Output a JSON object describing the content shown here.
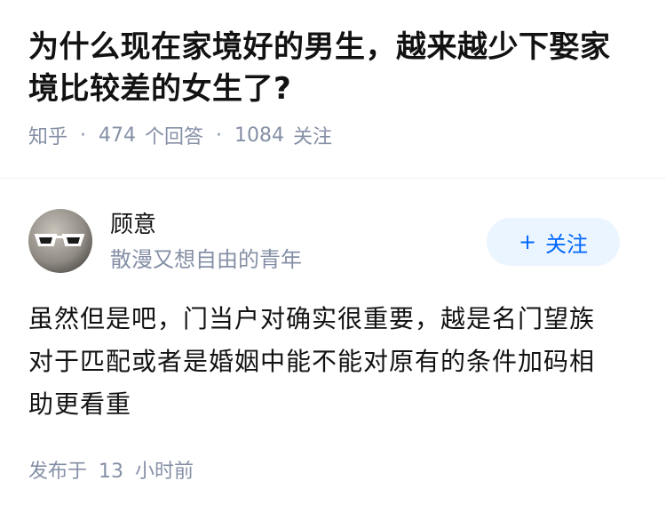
{
  "question": {
    "title_line1": "为什么现在家境好的男生，越来越少下娶家",
    "title_line2": "境比较差的女生了?",
    "source": "知乎",
    "answers_count": "474",
    "answers_label": "个回答",
    "followers_count": "1084",
    "followers_label": "关注"
  },
  "author": {
    "name": "顾意",
    "bio": "散漫又想自由的青年",
    "avatar_icon": "cat-with-sunglasses-avatar",
    "follow_plus": "+",
    "follow_label": "关注"
  },
  "answer": {
    "line1": "虽然但是吧，门当户对确实很重要，越是名门望族",
    "line2": "对于匹配或者是婚姻中能不能对原有的条件加码相",
    "line3": "助更看重",
    "published_prefix": "发布于",
    "published_num": "13",
    "published_suffix": "小时前"
  },
  "colors": {
    "accent": "#0066ff",
    "follow_bg": "#ebf5ff",
    "meta_text": "#8590a6",
    "main_text": "#121212"
  }
}
